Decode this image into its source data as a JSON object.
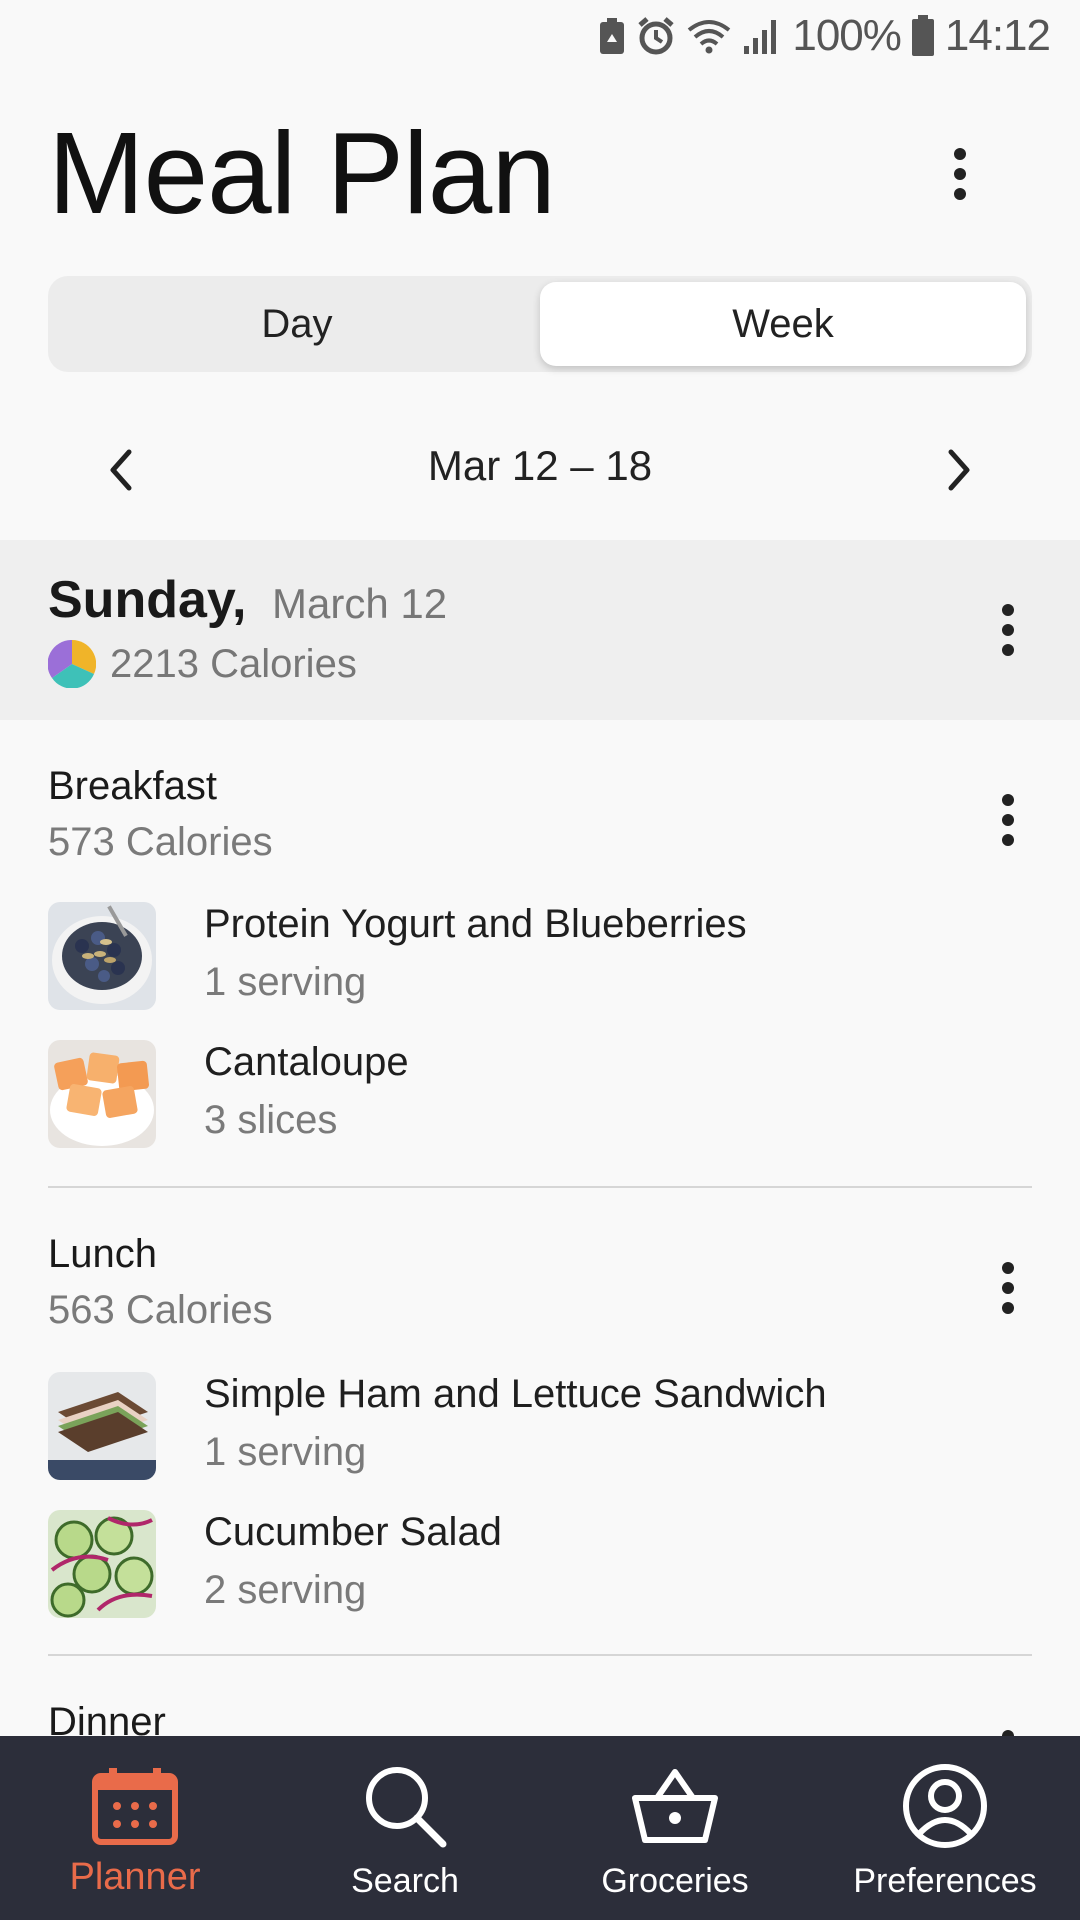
{
  "status_bar": {
    "battery_percent": "100%",
    "time": "14:12"
  },
  "header": {
    "title": "Meal Plan"
  },
  "view_toggle": {
    "options": [
      "Day",
      "Week"
    ],
    "selected": "Week"
  },
  "week_nav": {
    "range": "Mar 12 – 18"
  },
  "day": {
    "name": "Sunday,",
    "date": "March 12",
    "calories": "2213 Calories",
    "macro_chart_colors": [
      "#9b6fd8",
      "#f0b429",
      "#3ec1b8"
    ]
  },
  "meals": [
    {
      "title": "Breakfast",
      "calories": "573 Calories",
      "items": [
        {
          "name": "Protein Yogurt and Blueberries",
          "quantity": "1 serving",
          "thumb": "yogurt-blueberries"
        },
        {
          "name": "Cantaloupe",
          "quantity": "3 slices",
          "thumb": "cantaloupe"
        }
      ]
    },
    {
      "title": "Lunch",
      "calories": "563 Calories",
      "items": [
        {
          "name": "Simple Ham and Lettuce Sandwich",
          "quantity": "1 serving",
          "thumb": "ham-sandwich"
        },
        {
          "name": "Cucumber Salad",
          "quantity": "2 serving",
          "thumb": "cucumber-salad"
        }
      ]
    },
    {
      "title": "Dinner"
    }
  ],
  "bottom_nav": {
    "items": [
      {
        "label": "Planner",
        "icon": "calendar-icon",
        "active": true
      },
      {
        "label": "Search",
        "icon": "search-icon",
        "active": false
      },
      {
        "label": "Groceries",
        "icon": "basket-icon",
        "active": false
      },
      {
        "label": "Preferences",
        "icon": "profile-icon",
        "active": false
      }
    ],
    "active_color": "#e96b4a"
  }
}
